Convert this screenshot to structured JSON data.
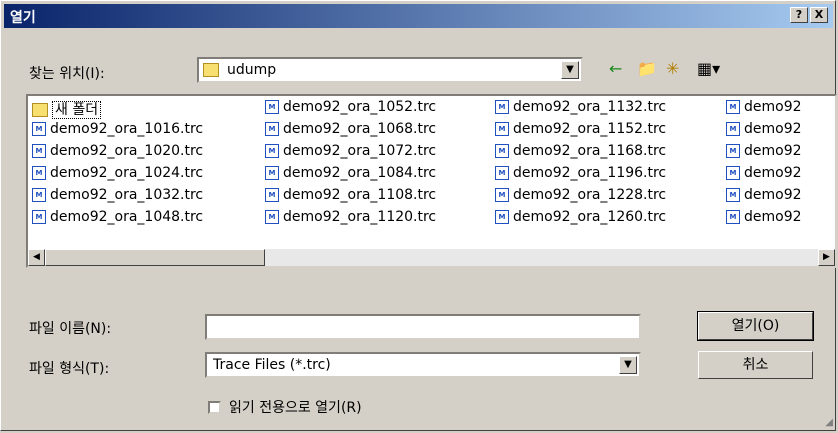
{
  "dialog": {
    "title": "열기",
    "help_label": "?",
    "close_label": "X"
  },
  "lookin": {
    "label": "찾는 위치(I):",
    "value": "udump",
    "dropdown_glyph": "▼"
  },
  "toolbar": {
    "back_icon": "←",
    "up_folder_icon": "📁",
    "new_folder_icon": "✳",
    "view_menu_icon": "▦▾"
  },
  "files": [
    [
      "새 폴더",
      "demo92_ora_1016.trc",
      "demo92_ora_1020.trc",
      "demo92_ora_1024.trc",
      "demo92_ora_1032.trc",
      "demo92_ora_1048.trc"
    ],
    [
      "demo92_ora_1052.trc",
      "demo92_ora_1068.trc",
      "demo92_ora_1072.trc",
      "demo92_ora_1084.trc",
      "demo92_ora_1108.trc",
      "demo92_ora_1120.trc"
    ],
    [
      "demo92_ora_1132.trc",
      "demo92_ora_1152.trc",
      "demo92_ora_1168.trc",
      "demo92_ora_1196.trc",
      "demo92_ora_1228.trc",
      "demo92_ora_1260.trc"
    ],
    [
      "demo92",
      "demo92",
      "demo92",
      "demo92",
      "demo92",
      "demo92"
    ]
  ],
  "scroll": {
    "left_arrow": "◀",
    "right_arrow": "▶"
  },
  "filename": {
    "label": "파일 이름(N):",
    "value": ""
  },
  "filetype": {
    "label": "파일 형식(T):",
    "value": "Trace Files (*.trc)",
    "dropdown_glyph": "▼"
  },
  "readonly": {
    "label": "읽기 전용으로 열기(R)",
    "checked": false
  },
  "buttons": {
    "open": "열기(O)",
    "cancel": "취소"
  }
}
